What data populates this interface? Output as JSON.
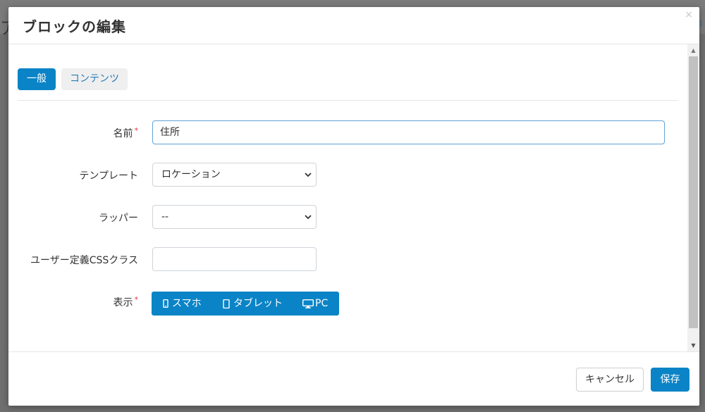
{
  "background": {
    "left_char": "ア",
    "right_char": "り"
  },
  "modal": {
    "title": "ブロックの編集",
    "close_symbol": "×"
  },
  "tabs": [
    {
      "label": "一般",
      "active": true
    },
    {
      "label": "コンテンツ",
      "active": false
    }
  ],
  "form": {
    "name": {
      "label": "名前",
      "required": "*",
      "value": "住所"
    },
    "template": {
      "label": "テンプレート",
      "selected": "ロケーション"
    },
    "wrapper": {
      "label": "ラッパー",
      "selected": "--"
    },
    "css_class": {
      "label": "ユーザー定義CSSクラス",
      "value": ""
    },
    "display": {
      "label": "表示",
      "required": "*",
      "options": [
        {
          "label": "スマホ",
          "icon": "mobile-icon"
        },
        {
          "label": "タブレット",
          "icon": "tablet-icon"
        },
        {
          "label": "PC",
          "icon": "desktop-icon"
        }
      ]
    }
  },
  "footer": {
    "cancel": "キャンセル",
    "save": "保存"
  },
  "colors": {
    "primary": "#0a84c7",
    "required": "#e33b3b"
  }
}
